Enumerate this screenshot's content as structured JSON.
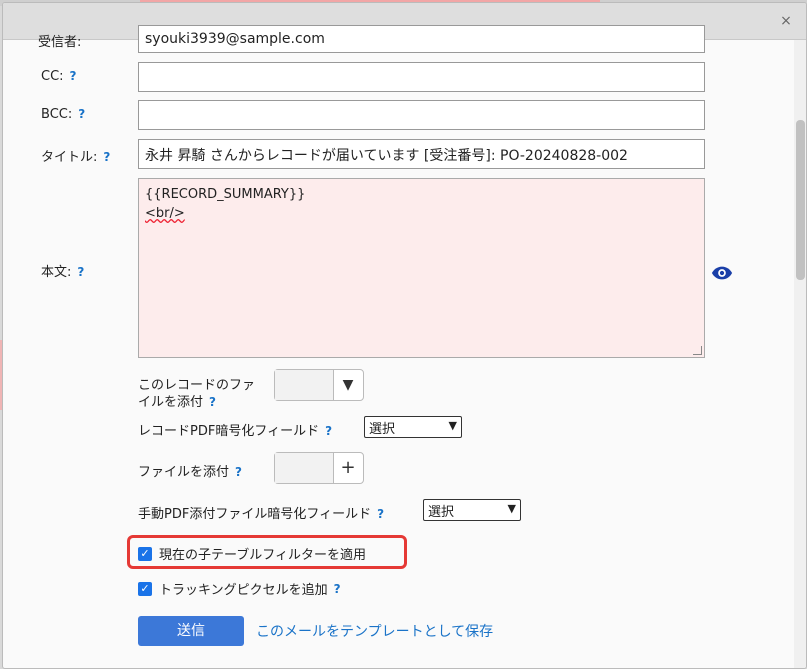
{
  "dialog": {
    "close_glyph": "×"
  },
  "fields": {
    "to_label": "受信者:",
    "to_value": "syouki3939@sample.com",
    "cc_label": "CC:",
    "cc_value": "",
    "bcc_label": "BCC:",
    "bcc_value": "",
    "title_label": "タイトル:",
    "title_value": "永井 昇騎 さんからレコードが届いています [受注番号]: PO-20240828-002",
    "body_label": "本文:",
    "body_line1": "{{RECORD_SUMMARY}}",
    "body_line2": "<br/>"
  },
  "help_glyph": "?",
  "attach": {
    "record_files_label_line1": "このレコードのファ",
    "record_files_label_line2": "イルを添付",
    "record_files_button_glyph": "▼",
    "pdf_encrypt_label": "レコードPDF暗号化フィールド",
    "pdf_encrypt_selected": "選択",
    "file_attach_label": "ファイルを添付",
    "file_attach_button_glyph": "+",
    "manual_pdf_label": "手動PDF添付ファイル暗号化フィールド",
    "manual_pdf_selected": "選択"
  },
  "options": {
    "apply_child_filter_label": "現在の子テーブルフィルターを適用",
    "apply_child_filter_checked": true,
    "tracking_pixel_label": "トラッキングピクセルを追加",
    "tracking_pixel_checked": true
  },
  "actions": {
    "send_label": "送信",
    "save_template_label": "このメールをテンプレートとして保存"
  },
  "colors": {
    "accent": "#1a73e8",
    "send_button": "#3c78d8",
    "link": "#1a73c8",
    "highlight_border": "#e53935",
    "body_background": "#fdecec"
  },
  "icons": {
    "close": "close-icon",
    "preview": "eye-icon",
    "dropdown": "chevron-down-icon",
    "add": "plus-icon",
    "check": "checkmark-icon"
  }
}
